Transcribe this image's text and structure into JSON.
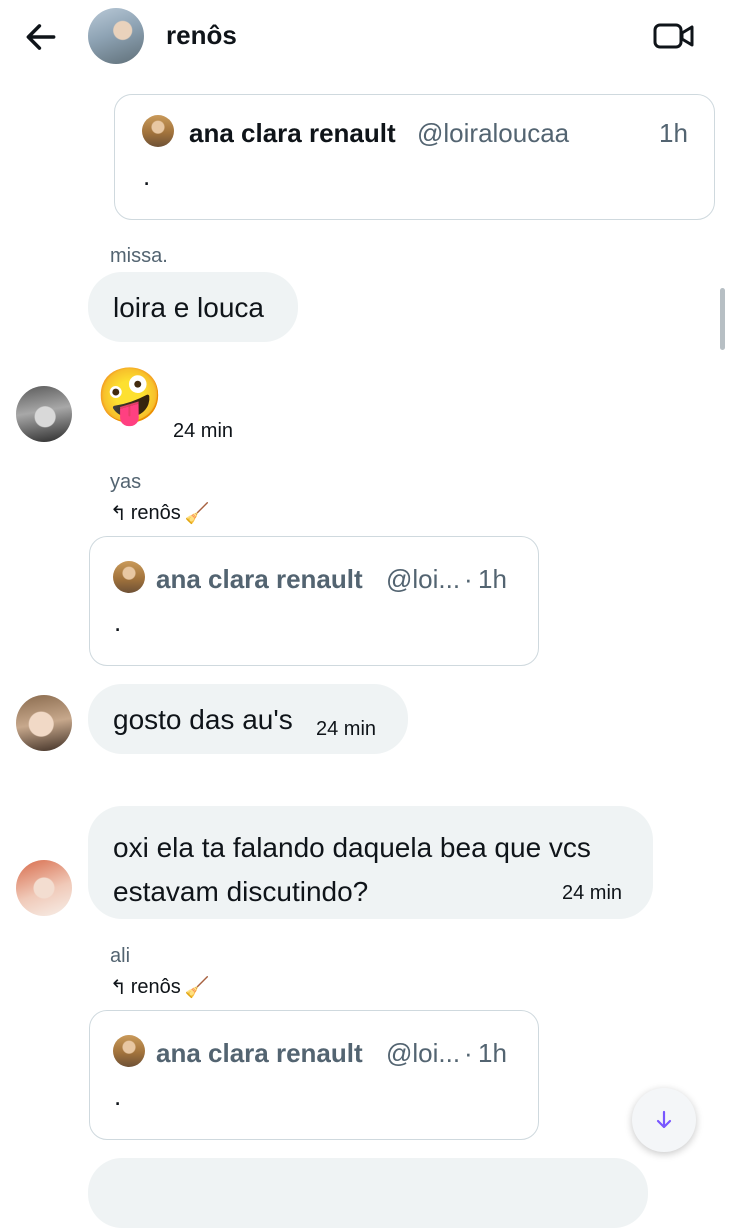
{
  "header": {
    "title": "renôs"
  },
  "messages": {
    "q1": {
      "name": "ana clara renault",
      "handle": "@loiraloucaa",
      "time": "1h",
      "body": "."
    },
    "m1": {
      "sender": "missa.",
      "text": "loira e louca"
    },
    "m2": {
      "emoji": "🤪",
      "time": "24 min"
    },
    "m3": {
      "sender": "yas",
      "reply_to": "renôs",
      "reply_icon": "↰",
      "reply_emoji": "🧹",
      "quote": {
        "name": "ana clara renault",
        "handle": "@loi...",
        "sep": "·",
        "time": "1h",
        "body": "."
      }
    },
    "m4": {
      "text": "gosto das au's",
      "time": "24 min"
    },
    "m5": {
      "line1": "oxi ela ta falando daquela bea que vcs",
      "line2": "estavam discutindo?",
      "time": "24 min"
    },
    "m6": {
      "sender": "ali",
      "reply_to": "renôs",
      "reply_icon": "↰",
      "reply_emoji": "🧹",
      "quote": {
        "name": "ana clara renault",
        "handle": "@loi...",
        "sep": "·",
        "time": "1h",
        "body": "."
      }
    }
  },
  "icons": {
    "back": "arrow-left-icon",
    "video": "video-camera-icon",
    "scroll_down": "arrow-down-icon"
  },
  "colors": {
    "accent": "#7856ff",
    "bubble": "#eff3f4",
    "border": "#cfd9de",
    "muted": "#536471"
  }
}
